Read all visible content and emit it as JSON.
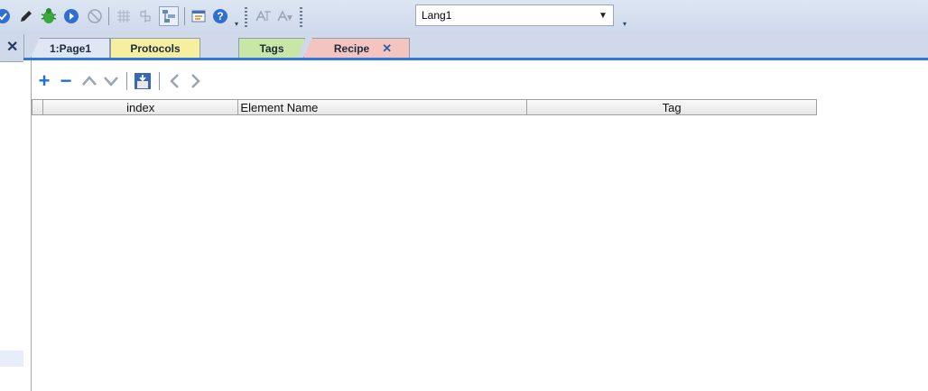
{
  "toolbar": {
    "language_select": {
      "value": "Lang1"
    },
    "icons": [
      "verify-icon",
      "pencil-icon",
      "debug-icon",
      "run-icon",
      "stop-icon",
      "grid-icon",
      "align-icon",
      "layout-icon",
      "properties-icon",
      "help-icon",
      "translate-icon",
      "translate-font-icon"
    ]
  },
  "left_panel": {
    "close_glyph": "✕"
  },
  "tabs": [
    {
      "label": "1:Page1",
      "color": "#dfe7f4"
    },
    {
      "label": "Protocols",
      "color": "#f5ef9f"
    },
    {
      "label": "Tags",
      "color": "#c8e6a6"
    },
    {
      "label": "Recipe",
      "color": "#f4c4c0",
      "active": true,
      "close": "✕"
    }
  ],
  "recipe_toolbar": {
    "add": "+",
    "remove": "−",
    "up": "∧",
    "down": "∨",
    "prev": "‹",
    "next": "›",
    "icons": [
      "add-icon",
      "remove-icon",
      "move-up-icon",
      "move-down-icon",
      "import-icon",
      "previous-icon",
      "next-icon"
    ]
  },
  "table": {
    "columns": [
      "index",
      "Element Name",
      "Tag"
    ],
    "rows": []
  },
  "colors": {
    "accent": "#2f78d8",
    "background": "#cfd9ea"
  }
}
